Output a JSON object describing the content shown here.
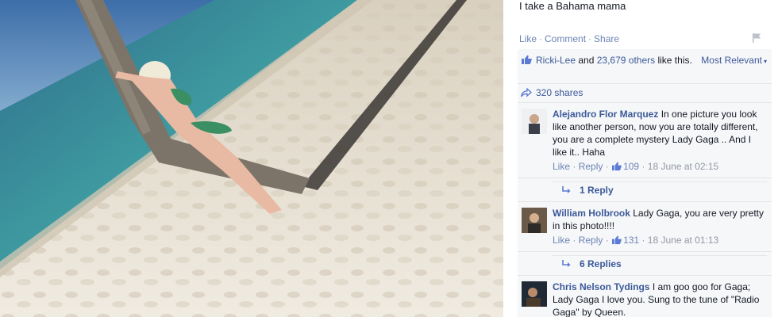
{
  "post": {
    "caption": "I take a Bahama mama",
    "actions": {
      "like": "Like",
      "comment": "Comment",
      "share": "Share",
      "separator": "·"
    }
  },
  "likes": {
    "first_name": "Ricki-Lee",
    "connector": "and",
    "others": "23,679 others",
    "suffix": "like this.",
    "sort": "Most Relevant"
  },
  "shares": {
    "label": "320 shares"
  },
  "comments": [
    {
      "name": "Alejandro Flor Marquez",
      "text": "In one picture you look like another person, now you are totally different, you are a complete mystery Lady Gaga .. And I like it.. Haha",
      "like": "Like",
      "reply": "Reply",
      "likes": "109",
      "time": "18 June at 02:15",
      "replies": "1 Reply"
    },
    {
      "name": "William Holbrook",
      "text": "Lady Gaga, you are very pretty in this photo!!!!",
      "like": "Like",
      "reply": "Reply",
      "likes": "131",
      "time": "18 June at 01:13",
      "replies": "6 Replies"
    },
    {
      "name": "Chris Nelson Tydings",
      "text": "I am goo goo for Gaga; Lady Gaga I love you. Sung to the tune of \"Radio Gaga\" by Queen."
    }
  ],
  "colors": {
    "link": "#3b5998",
    "action": "#6d84b4",
    "muted": "#9197a3",
    "panel_bg": "#f6f7f9",
    "sand": "#e9e2d4",
    "sea": "#3f8f96"
  }
}
